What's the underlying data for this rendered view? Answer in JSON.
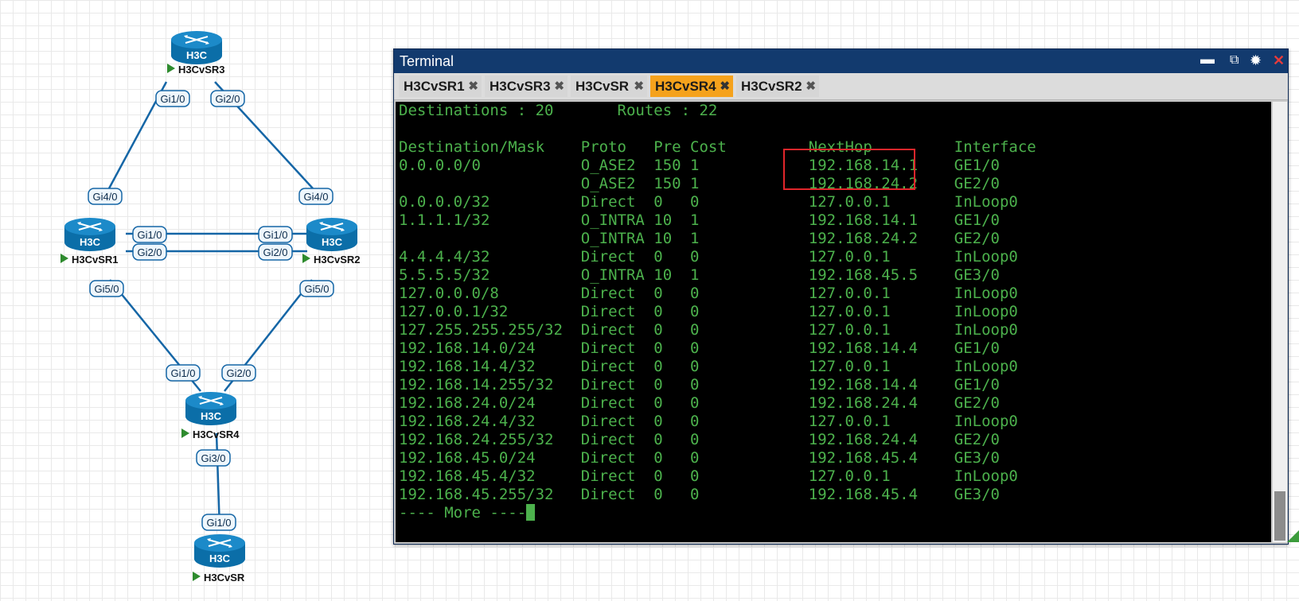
{
  "topology": {
    "routers": [
      {
        "id": "sr3",
        "name": "H3CvSR3",
        "logo": "H3C"
      },
      {
        "id": "sr1",
        "name": "H3CvSR1",
        "logo": "H3C"
      },
      {
        "id": "sr2",
        "name": "H3CvSR2",
        "logo": "H3C"
      },
      {
        "id": "sr4",
        "name": "H3CvSR4",
        "logo": "H3C"
      },
      {
        "id": "sr",
        "name": "H3CvSR",
        "logo": "H3C"
      }
    ],
    "interfaces": {
      "sr3_gi1": "Gi1/0",
      "sr3_gi2": "Gi2/0",
      "sr1_gi4": "Gi4/0",
      "sr2_gi4": "Gi4/0",
      "sr1_gi1": "Gi1/0",
      "sr2_gi1": "Gi1/0",
      "sr1_gi2": "Gi2/0",
      "sr2_gi2": "Gi2/0",
      "sr1_gi5": "Gi5/0",
      "sr2_gi5": "Gi5/0",
      "sr4_gi1": "Gi1/0",
      "sr4_gi2": "Gi2/0",
      "sr4_gi3": "Gi3/0",
      "sr_gi1": "Gi1/0"
    }
  },
  "terminal": {
    "title": "Terminal",
    "tabs": [
      {
        "label": "H3CvSR1",
        "active": false
      },
      {
        "label": "H3CvSR3",
        "active": false
      },
      {
        "label": "H3CvSR",
        "active": false
      },
      {
        "label": "H3CvSR4",
        "active": true
      },
      {
        "label": "H3CvSR2",
        "active": false
      }
    ],
    "lines": [
      "Destinations : 20       Routes : 22",
      "",
      "Destination/Mask    Proto   Pre Cost         NextHop         Interface",
      "0.0.0.0/0           O_ASE2  150 1            192.168.14.1    GE1/0",
      "                    O_ASE2  150 1            192.168.24.2    GE2/0",
      "0.0.0.0/32          Direct  0   0            127.0.0.1       InLoop0",
      "1.1.1.1/32          O_INTRA 10  1            192.168.14.1    GE1/0",
      "                    O_INTRA 10  1            192.168.24.2    GE2/0",
      "4.4.4.4/32          Direct  0   0            127.0.0.1       InLoop0",
      "5.5.5.5/32          O_INTRA 10  1            192.168.45.5    GE3/0",
      "127.0.0.0/8         Direct  0   0            127.0.0.1       InLoop0",
      "127.0.0.1/32        Direct  0   0            127.0.0.1       InLoop0",
      "127.255.255.255/32  Direct  0   0            127.0.0.1       InLoop0",
      "192.168.14.0/24     Direct  0   0            192.168.14.4    GE1/0",
      "192.168.14.4/32     Direct  0   0            127.0.0.1       InLoop0",
      "192.168.14.255/32   Direct  0   0            192.168.14.4    GE1/0",
      "192.168.24.0/24     Direct  0   0            192.168.24.4    GE2/0",
      "192.168.24.4/32     Direct  0   0            127.0.0.1       InLoop0",
      "192.168.24.255/32   Direct  0   0            192.168.24.4    GE2/0",
      "192.168.45.0/24     Direct  0   0            192.168.45.4    GE3/0",
      "192.168.45.4/32     Direct  0   0            127.0.0.1       InLoop0",
      "192.168.45.255/32   Direct  0   0            192.168.45.4    GE3/0"
    ],
    "more_prompt": "---- More ----",
    "colors": {
      "text": "#4cb14c",
      "background": "#000000",
      "titlebar": "#123a6e",
      "active_tab": "#f5a21c",
      "highlight": "#e1262b"
    },
    "icons": {
      "minimize": "minimize-icon",
      "maximize": "maximize-icon",
      "settings": "gear-icon",
      "close": "close-icon"
    }
  }
}
